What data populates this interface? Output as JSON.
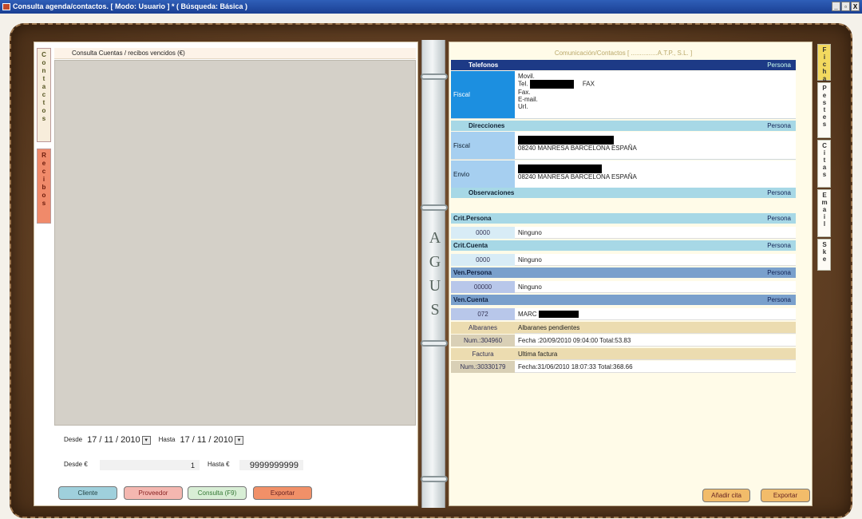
{
  "window": {
    "title": "Consulta agenda/contactos. [ Modo: Usuario ] * ( Búsqueda: Básica )",
    "controls": [
      "_",
      "▫",
      "X"
    ]
  },
  "left": {
    "tabs": [
      "Contactos",
      "Recibos"
    ],
    "header": "Consulta Cuentas / recibos vencidos (€)",
    "desde_label": "Desde",
    "desde_date": "17 / 11 / 2010",
    "hasta_label": "Hasta",
    "hasta_date": "17 / 11 / 2010",
    "desde_eur_label": "Desde €",
    "desde_eur_value": "1",
    "hasta_eur_label": "Hasta €",
    "hasta_eur_value": "9999999999",
    "buttons": {
      "cliente": "Cliente",
      "proveedor": "Proveedor",
      "consulta": "Consulta (F9)",
      "exportar": "Exportar"
    }
  },
  "spine": [
    "A",
    "G",
    "U",
    "S"
  ],
  "right": {
    "header": "Comunicación/Contactos [ ...............A.T.P., S.L. ]",
    "tabs": [
      "Ficha",
      "Pestes",
      "Citas",
      "Email",
      "Ske"
    ],
    "telefonos": {
      "title": "Telefonos",
      "right": "Persona",
      "label": "Fiscal",
      "lines": [
        "Movil.",
        "Tel.",
        "FAX",
        "Fax.",
        "E-mail.",
        "Url."
      ]
    },
    "direcciones": {
      "title": "Direcciones",
      "right": "Persona",
      "fiscal_label": "Fiscal",
      "fiscal_addr": "08240 MANRESA BARCELONA ESPAÑA",
      "envio_label": "Envio",
      "envio_addr": "08240 MANRESA BARCELONA ESPAÑA"
    },
    "observaciones": {
      "title": "Observaciones",
      "right": "Persona"
    },
    "crit_persona": {
      "title": "Crit.Persona",
      "right": "Persona",
      "code": "0000",
      "text": "Ninguno"
    },
    "crit_cuenta": {
      "title": "Crit.Cuenta",
      "right": "Persona",
      "code": "0000",
      "text": "Ninguno"
    },
    "ven_persona": {
      "title": "Ven.Persona",
      "right": "Persona",
      "code": "00000",
      "text": "Ninguno"
    },
    "ven_cuenta": {
      "title": "Ven.Cuenta",
      "right": "Persona",
      "code": "072",
      "text": "MARC"
    },
    "albaranes": {
      "label": "Albaranes",
      "text": "Albaranes pendientes",
      "num": "Num.:304960",
      "detail": "Fecha :20/09/2010 09:04:00 Total:53.83"
    },
    "factura": {
      "label": "Factura",
      "text": "Ultima factura",
      "num": "Num.:30330179",
      "detail": "Fecha:31/06/2010 18:07:33 Total:368.66"
    },
    "buttons": {
      "anadir": "Añadir cita",
      "exportar": "Exportar"
    }
  }
}
